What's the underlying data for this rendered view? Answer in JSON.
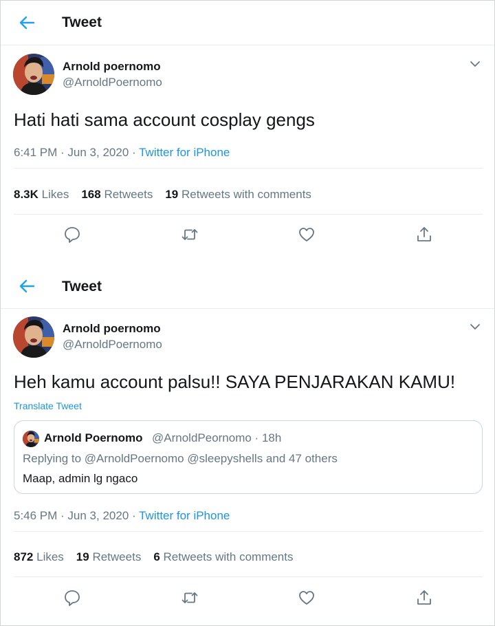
{
  "colors": {
    "accent": "#1da1f2",
    "link": "#1b95e0",
    "text": "#14171a",
    "muted": "#657786",
    "divider": "#e6ecf0"
  },
  "tweets": [
    {
      "header_title": "Tweet",
      "author_name": "Arnold poernomo",
      "author_handle": "@ArnoldPoernomo",
      "text": "Hati hati sama account cosplay gengs",
      "time": "6:41 PM",
      "date": "Jun 3, 2020",
      "source": "Twitter for iPhone",
      "likes_count": "8.3K",
      "likes_label": "Likes",
      "retweets_count": "168",
      "retweets_label": "Retweets",
      "rwc_count": "19",
      "rwc_label": "Retweets with comments"
    },
    {
      "header_title": "Tweet",
      "author_name": "Arnold poernomo",
      "author_handle": "@ArnoldPoernomo",
      "text": "Heh kamu account palsu!! SAYA PENJARAKAN KAMU!",
      "translate_label": "Translate Tweet",
      "quote": {
        "name": "Arnold Poernomo",
        "handle_time": "@ArnoldPeornomo · 18h",
        "replying": "Replying to @ArnoldPoernomo @sleepyshells and 47 others",
        "text": "Maap, admin lg ngaco"
      },
      "time": "5:46 PM",
      "date": "Jun 3, 2020",
      "source": "Twitter for iPhone",
      "likes_count": "872",
      "likes_label": "Likes",
      "retweets_count": "19",
      "retweets_label": "Retweets",
      "rwc_count": "6",
      "rwc_label": "Retweets with comments"
    }
  ],
  "icons": [
    "back-arrow-icon",
    "chevron-down-icon",
    "reply-icon",
    "retweet-icon",
    "like-icon",
    "share-icon"
  ]
}
